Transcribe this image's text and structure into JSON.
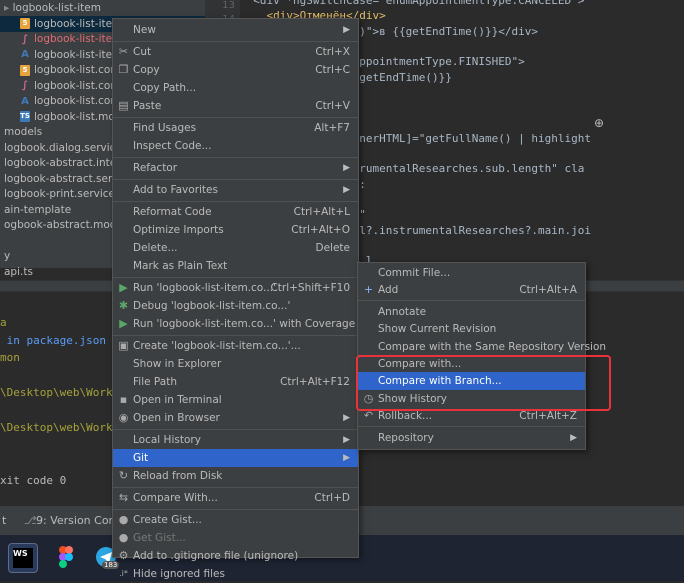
{
  "tree": {
    "items": [
      {
        "label": "logbook-list-item",
        "icon": "folder",
        "cls": "",
        "sel": false
      },
      {
        "label": "logbook-list-item.",
        "icon": "html",
        "cls": "",
        "sel": true
      },
      {
        "label": "logbook-list-item.",
        "icon": "scss",
        "cls": "t-red",
        "sel": false
      },
      {
        "label": "logbook-list-item.",
        "icon": "ng",
        "cls": "",
        "sel": false
      },
      {
        "label": "logbook-list.compone",
        "icon": "html",
        "cls": "",
        "sel": false
      },
      {
        "label": "logbook-list.compone",
        "icon": "scss",
        "cls": "",
        "sel": false
      },
      {
        "label": "logbook-list.compone",
        "icon": "ng",
        "cls": "",
        "sel": false
      },
      {
        "label": "logbook-list.model.ts",
        "icon": "ts",
        "cls": "",
        "sel": false
      },
      {
        "label": "models",
        "icon": "none",
        "cls": "",
        "sel": false
      },
      {
        "label": "logbook.dialog.service.ts",
        "icon": "none",
        "cls": "",
        "sel": false
      },
      {
        "label": "logbook-abstract.interfac",
        "icon": "none",
        "cls": "",
        "sel": false
      },
      {
        "label": "logbook-abstract.service.",
        "icon": "none",
        "cls": "",
        "sel": false
      },
      {
        "label": "logbook-print.service.ts",
        "icon": "none",
        "cls": "",
        "sel": false
      },
      {
        "label": "ain-template",
        "icon": "none",
        "cls": "",
        "sel": false
      },
      {
        "label": "ogbook-abstract.module.ts",
        "icon": "none",
        "cls": "",
        "sel": false
      },
      {
        "label": "",
        "icon": "none",
        "cls": "",
        "sel": false
      },
      {
        "label": "y",
        "icon": "none",
        "cls": "",
        "sel": false
      },
      {
        "label": "api.ts",
        "icon": "none",
        "cls": "",
        "sel": false
      }
    ]
  },
  "gutter": {
    "lines": [
      "13",
      "14"
    ]
  },
  "editor": {
    "lines": [
      "  <div *ngSwitchCase=\"enumAppointmentType.CANCELED\">",
      "    <div>Отменён</div>",
      "    f=\"getEndTime()\">в {{getEndTime()}}</div>",
      "",
      "    tchCase=\"enumAppointmentType.FINISHED\">",
      "    tTime()}} - {{getEndTime()}}",
      "",
      "",
      "    escription\">",
      "    \"fullname\" [innerHTML]=\"getFullName() | highlight",
      "    \"text\">",
      "    f=\"model?.instrumentalResearches.sub.length\" cla",
      "    е исследование:",
      "",
      "    ss=\"text_value\"",
      "    nerHTML]=\"model?.instrumentalResearches?.main.joi",
      "",
      "    researches.sub.l"
    ]
  },
  "terminal": {
    "lines": [
      {
        "text": "a",
        "style": "olive"
      },
      {
        "text": " in package.json",
        "style": "link"
      },
      {
        "text": "mon",
        "style": "olive"
      },
      {
        "text": "",
        "style": ""
      },
      {
        "text": "\\Desktop\\web\\Work",
        "style": "olive"
      },
      {
        "text": "",
        "style": ""
      },
      {
        "text": "\\Desktop\\web\\Work",
        "style": "olive"
      },
      {
        "text": "",
        "style": ""
      },
      {
        "text": "",
        "style": ""
      },
      {
        "text": "xit code 0",
        "style": ""
      }
    ]
  },
  "toolbar": {
    "left": "t",
    "version_control": "9: Version Control"
  },
  "taskbar": {
    "badge": "183"
  },
  "context_menu": {
    "items": [
      {
        "type": "item",
        "label": "New",
        "icon": "",
        "shortcut": "",
        "arrow": true
      },
      {
        "type": "sep"
      },
      {
        "type": "item",
        "label": "Cut",
        "icon": "✂",
        "shortcut": "Ctrl+X"
      },
      {
        "type": "item",
        "label": "Copy",
        "icon": "❐",
        "shortcut": "Ctrl+C"
      },
      {
        "type": "item",
        "label": "Copy Path...",
        "icon": "",
        "shortcut": ""
      },
      {
        "type": "item",
        "label": "Paste",
        "icon": "▤",
        "shortcut": "Ctrl+V"
      },
      {
        "type": "sep"
      },
      {
        "type": "item",
        "label": "Find Usages",
        "icon": "",
        "shortcut": "Alt+F7"
      },
      {
        "type": "item",
        "label": "Inspect Code...",
        "icon": "",
        "shortcut": ""
      },
      {
        "type": "sep"
      },
      {
        "type": "item",
        "label": "Refactor",
        "icon": "",
        "shortcut": "",
        "arrow": true
      },
      {
        "type": "sep"
      },
      {
        "type": "item",
        "label": "Add to Favorites",
        "icon": "",
        "shortcut": "",
        "arrow": true
      },
      {
        "type": "sep"
      },
      {
        "type": "item",
        "label": "Reformat Code",
        "icon": "",
        "shortcut": "Ctrl+Alt+L"
      },
      {
        "type": "item",
        "label": "Optimize Imports",
        "icon": "",
        "shortcut": "Ctrl+Alt+O"
      },
      {
        "type": "item",
        "label": "Delete...",
        "icon": "",
        "shortcut": "Delete"
      },
      {
        "type": "item",
        "label": "Mark as Plain Text",
        "icon": "",
        "shortcut": ""
      },
      {
        "type": "sep"
      },
      {
        "type": "item",
        "label": "Run 'logbook-list-item.co...'",
        "icon": "▶",
        "shortcut": "Ctrl+Shift+F10"
      },
      {
        "type": "item",
        "label": "Debug 'logbook-list-item.co...'",
        "icon": "✱",
        "shortcut": ""
      },
      {
        "type": "item",
        "label": "Run 'logbook-list-item.co...' with Coverage",
        "icon": "▶",
        "shortcut": ""
      },
      {
        "type": "sep"
      },
      {
        "type": "item",
        "label": "Create 'logbook-list-item.co...'...",
        "icon": "▣",
        "shortcut": ""
      },
      {
        "type": "item",
        "label": "Show in Explorer",
        "icon": "",
        "shortcut": ""
      },
      {
        "type": "item",
        "label": "File Path",
        "icon": "",
        "shortcut": "Ctrl+Alt+F12"
      },
      {
        "type": "item",
        "label": "Open in Terminal",
        "icon": "▪",
        "shortcut": ""
      },
      {
        "type": "item",
        "label": "Open in Browser",
        "icon": "◉",
        "shortcut": "",
        "arrow": true
      },
      {
        "type": "sep"
      },
      {
        "type": "item",
        "label": "Local History",
        "icon": "",
        "shortcut": "",
        "arrow": true
      },
      {
        "type": "item",
        "label": "Git",
        "icon": "",
        "shortcut": "",
        "arrow": true,
        "hl": true
      },
      {
        "type": "item",
        "label": "Reload from Disk",
        "icon": "↻",
        "shortcut": ""
      },
      {
        "type": "sep"
      },
      {
        "type": "item",
        "label": "Compare With...",
        "icon": "⇆",
        "shortcut": "Ctrl+D"
      },
      {
        "type": "sep"
      },
      {
        "type": "item",
        "label": "Create Gist...",
        "icon": "●",
        "shortcut": ""
      },
      {
        "type": "item",
        "label": "Get Gist...",
        "icon": "●",
        "shortcut": "",
        "dis": true
      },
      {
        "type": "item",
        "label": "Add to .gitignore file (unignore)",
        "icon": "⚙",
        "shortcut": ""
      },
      {
        "type": "item",
        "label": "Hide ignored files",
        "icon": ".i*",
        "shortcut": ""
      }
    ]
  },
  "git_menu": {
    "items": [
      {
        "type": "item",
        "label": "Commit File...",
        "icon": "",
        "shortcut": ""
      },
      {
        "type": "item",
        "label": "Add",
        "icon": "+",
        "shortcut": "Ctrl+Alt+A"
      },
      {
        "type": "sep"
      },
      {
        "type": "item",
        "label": "Annotate",
        "icon": "",
        "shortcut": ""
      },
      {
        "type": "item",
        "label": "Show Current Revision",
        "icon": "",
        "shortcut": ""
      },
      {
        "type": "item",
        "label": "Compare with the Same Repository Version",
        "icon": "",
        "shortcut": ""
      },
      {
        "type": "item",
        "label": "Compare with...",
        "icon": "",
        "shortcut": ""
      },
      {
        "type": "item",
        "label": "Compare with Branch...",
        "icon": "",
        "shortcut": "",
        "hl": true
      },
      {
        "type": "item",
        "label": "Show History",
        "icon": "◷",
        "shortcut": ""
      },
      {
        "type": "item",
        "label": "Rollback...",
        "icon": "↶",
        "shortcut": "Ctrl+Alt+Z"
      },
      {
        "type": "sep"
      },
      {
        "type": "item",
        "label": "Repository",
        "icon": "",
        "shortcut": "",
        "arrow": true
      }
    ]
  },
  "colors": {
    "highlight": "#2f65ca",
    "annotation": "#e8333c",
    "menu_bg": "#3c3f41"
  }
}
